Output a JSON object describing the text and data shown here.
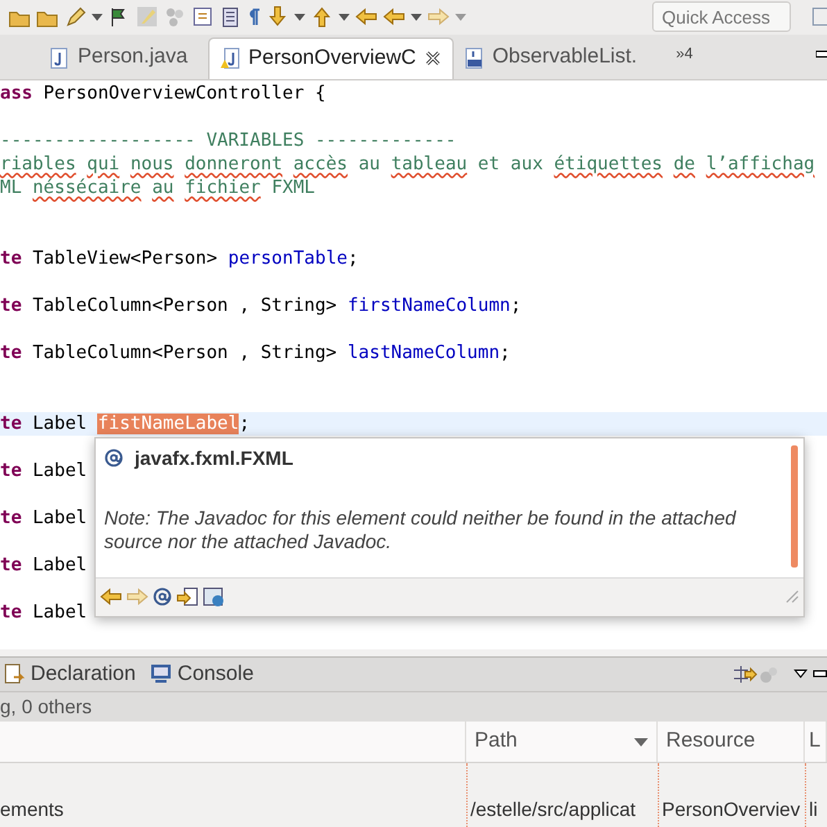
{
  "toolbar": {
    "quick_access": {
      "placeholder": "Quick Access"
    }
  },
  "editor_tabs": [
    {
      "label": "Person.java",
      "selected": false
    },
    {
      "label": "PersonOverviewC",
      "selected": true
    },
    {
      "label": "ObservableList.",
      "selected": false
    }
  ],
  "more_tabs": "»4",
  "code_lines": [
    {
      "kind": "code",
      "segments": [
        {
          "kind": "keyword",
          "text": "ass"
        },
        {
          "kind": "plain",
          "text": " PersonOverviewController {"
        }
      ]
    },
    {
      "kind": "blank"
    },
    {
      "kind": "code",
      "segments": [
        {
          "kind": "comment",
          "text": "------------------ VARIABLES -------------"
        }
      ]
    },
    {
      "kind": "code",
      "segments": [
        {
          "kind": "comment",
          "text": "riables ",
          "misspelled": true
        },
        {
          "kind": "comment",
          "text": "qui ",
          "misspelled": true
        },
        {
          "kind": "comment",
          "text": "nous ",
          "misspelled": true
        },
        {
          "kind": "comment",
          "text": "donneront ",
          "misspelled": true
        },
        {
          "kind": "comment",
          "text": "accès",
          "misspelled": true
        },
        {
          "kind": "comment",
          "text": " au "
        },
        {
          "kind": "comment",
          "text": "tableau",
          "misspelled": true
        },
        {
          "kind": "comment",
          "text": " et aux "
        },
        {
          "kind": "comment",
          "text": "étiquettes ",
          "misspelled": true
        },
        {
          "kind": "comment",
          "text": "de ",
          "misspelled": true
        },
        {
          "kind": "comment",
          "text": "l’affichag",
          "misspelled": true
        }
      ]
    },
    {
      "kind": "code",
      "segments": [
        {
          "kind": "comment",
          "text": "ML "
        },
        {
          "kind": "comment",
          "text": "néssécaire ",
          "misspelled": true
        },
        {
          "kind": "comment",
          "text": "au ",
          "misspelled": true
        },
        {
          "kind": "comment",
          "text": "fichier",
          "misspelled": true
        },
        {
          "kind": "comment",
          "text": " FXML"
        }
      ]
    },
    {
      "kind": "blank"
    },
    {
      "kind": "blank"
    },
    {
      "kind": "code",
      "segments": [
        {
          "kind": "keyword",
          "text": "te"
        },
        {
          "kind": "plain",
          "text": " TableView<Person> "
        },
        {
          "kind": "field",
          "text": "personTable"
        },
        {
          "kind": "plain",
          "text": ";"
        }
      ]
    },
    {
      "kind": "blank"
    },
    {
      "kind": "code",
      "segments": [
        {
          "kind": "keyword",
          "text": "te"
        },
        {
          "kind": "plain",
          "text": " TableColumn<Person , String> "
        },
        {
          "kind": "field",
          "text": "firstNameColumn"
        },
        {
          "kind": "plain",
          "text": ";"
        }
      ]
    },
    {
      "kind": "blank"
    },
    {
      "kind": "code",
      "segments": [
        {
          "kind": "keyword",
          "text": "te"
        },
        {
          "kind": "plain",
          "text": " TableColumn<Person , String> "
        },
        {
          "kind": "field",
          "text": "lastNameColumn"
        },
        {
          "kind": "plain",
          "text": ";"
        }
      ]
    },
    {
      "kind": "blank"
    },
    {
      "kind": "blank"
    },
    {
      "kind": "code",
      "current": true,
      "segments": [
        {
          "kind": "keyword",
          "text": "te"
        },
        {
          "kind": "plain",
          "text": " Label "
        },
        {
          "kind": "selection",
          "text": "fistNameLabel"
        },
        {
          "kind": "plain",
          "text": ";"
        }
      ]
    },
    {
      "kind": "blank"
    },
    {
      "kind": "code",
      "segments": [
        {
          "kind": "keyword",
          "text": "te"
        },
        {
          "kind": "plain",
          "text": " Label"
        }
      ]
    },
    {
      "kind": "blank"
    },
    {
      "kind": "code",
      "segments": [
        {
          "kind": "keyword",
          "text": "te"
        },
        {
          "kind": "plain",
          "text": " Label"
        }
      ]
    },
    {
      "kind": "blank"
    },
    {
      "kind": "code",
      "segments": [
        {
          "kind": "keyword",
          "text": "te"
        },
        {
          "kind": "plain",
          "text": " Label"
        }
      ]
    },
    {
      "kind": "blank"
    },
    {
      "kind": "code",
      "segments": [
        {
          "kind": "keyword",
          "text": "te"
        },
        {
          "kind": "plain",
          "text": " Label"
        }
      ]
    }
  ],
  "hover_popup": {
    "title": "javafx.fxml.FXML",
    "note": "Note: The Javadoc for this element could neither be found in the attached source nor the attached Javadoc."
  },
  "bottom_tabs": [
    {
      "label": "Declaration"
    },
    {
      "label": "Console"
    }
  ],
  "problems_summary": "g, 0 others",
  "table": {
    "columns": [
      {
        "sorted": false
      },
      {
        "label": "Path",
        "sorted": true
      },
      {
        "label": "Resource",
        "sorted": false
      },
      {
        "label": "L",
        "sorted": false
      }
    ],
    "rows": [
      [
        "ements",
        "/estelle/src/applicat",
        "PersonOverviev",
        "li"
      ]
    ]
  }
}
